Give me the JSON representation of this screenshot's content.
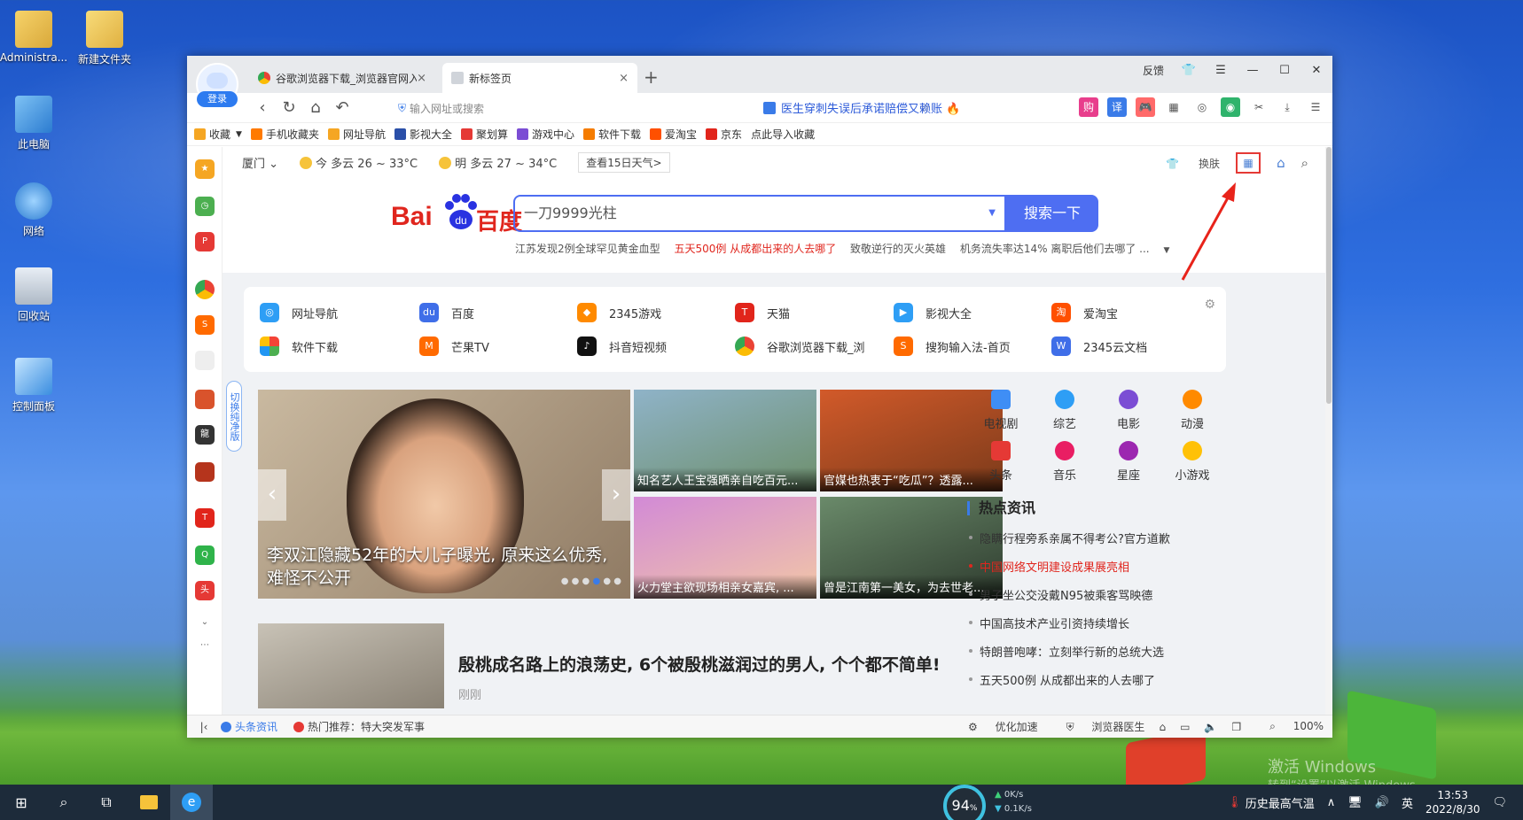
{
  "desktop": {
    "icons": [
      {
        "label": "Administra..."
      },
      {
        "label": "新建文件夹"
      },
      {
        "label": "此电脑"
      },
      {
        "label": "网络"
      },
      {
        "label": "回收站"
      },
      {
        "label": "控制面板"
      }
    ],
    "activation_watermark": "激活 Windows",
    "activation_hint": "转到“设置”以激活 Windows。"
  },
  "browser": {
    "login_label": "登录",
    "tabs": [
      {
        "label": "谷歌浏览器下载_浏览器官网入口",
        "close": "×"
      },
      {
        "label": "新标签页",
        "close": "×"
      }
    ],
    "new_tab": "+",
    "feedback": "反馈",
    "address_placeholder": "输入网址或搜索",
    "ad_text": "医生穿刺失误后承诺赔偿又赖账",
    "bookmarks": [
      {
        "label": "收藏",
        "color": "#f5a623"
      },
      {
        "label": "手机收藏夹",
        "color": "#ff7a00"
      },
      {
        "label": "网址导航",
        "color": "#f5a623"
      },
      {
        "label": "影视大全",
        "color": "#2a4fa8"
      },
      {
        "label": "聚划算",
        "color": "#e53935"
      },
      {
        "label": "游戏中心",
        "color": "#7b4dd4"
      },
      {
        "label": "软件下载",
        "color": "#f57c00"
      },
      {
        "label": "爱淘宝",
        "color": "#ff5000"
      },
      {
        "label": "京东",
        "color": "#e1251b"
      },
      {
        "label": "点此导入收藏",
        "color": "#ffffff"
      }
    ]
  },
  "weather": {
    "city": "厦门",
    "today": "今 多云 26 ~ 33°C",
    "tomorrow": "明 多云 27 ~ 34°C",
    "forecast_button": "查看15日天气>",
    "skin": "换肤"
  },
  "search": {
    "query": "一刀9999光柱",
    "button": "搜索一下",
    "logo_bai": "Bai",
    "logo_du": "du",
    "logo_cn": "百度",
    "hot_links": [
      {
        "text": "江苏发现2例全球罕见黄金血型",
        "red": false
      },
      {
        "text": "五天500例 从成都出来的人去哪了",
        "red": true
      },
      {
        "text": "致敬逆行的灭火英雄",
        "red": false
      },
      {
        "text": "机务流失率达14% 离职后他们去哪了 ...",
        "red": false
      }
    ]
  },
  "sites": [
    {
      "label": "网址导航",
      "color": "#2e9ef5"
    },
    {
      "label": "百度",
      "color": "#3f6ee8"
    },
    {
      "label": "2345游戏",
      "color": "#ff8a00"
    },
    {
      "label": "天猫",
      "color": "#e1251b"
    },
    {
      "label": "影视大全",
      "color": "#2e9ef5"
    },
    {
      "label": "爱淘宝",
      "color": "#ff5000"
    },
    {
      "label": "软件下载",
      "color": "#4caf50"
    },
    {
      "label": "芒果TV",
      "color": "#ff6a00"
    },
    {
      "label": "抖音短视频",
      "color": "#111111"
    },
    {
      "label": "谷歌浏览器下载_浏",
      "color": "#34a853"
    },
    {
      "label": "搜狗输入法-首页",
      "color": "#ff6a00"
    },
    {
      "label": "2345云文档",
      "color": "#3f6ee8"
    }
  ],
  "switch_pure": "切换纯净版",
  "feed": {
    "big_caption": "李双江隐藏52年的大儿子曝光, 原来这么优秀, 难怪不公开",
    "small": [
      {
        "caption": "知名艺人王宝强晒亲自吃百元..."
      },
      {
        "caption": "官媒也热衷于“吃瓜”？透露..."
      },
      {
        "caption": "火力堂主欲现场相亲女嘉宾, ..."
      },
      {
        "caption": "曾是江南第一美女，为去世老..."
      }
    ],
    "article_title": "殷桃成名路上的浪荡史, 6个被殷桃滋润过的男人, 个个都不简单!",
    "article_time": "刚刚"
  },
  "categories": [
    {
      "label": "电视剧",
      "color": "#3f8ef5"
    },
    {
      "label": "综艺",
      "color": "#2e9ef5"
    },
    {
      "label": "电影",
      "color": "#7b4dd4"
    },
    {
      "label": "动漫",
      "color": "#ff8a00"
    },
    {
      "label": "头条",
      "color": "#e53935"
    },
    {
      "label": "音乐",
      "color": "#e91e63"
    },
    {
      "label": "星座",
      "color": "#9c27b0"
    },
    {
      "label": "小游戏",
      "color": "#ffc107"
    }
  ],
  "hot_news": {
    "title": "热点资讯",
    "items": [
      {
        "text": "隐瞒行程旁系亲属不得考公?官方道歉",
        "red": false
      },
      {
        "text": "中国网络文明建设成果展亮相",
        "red": true
      },
      {
        "text": "男子坐公交没戴N95被乘客骂映德",
        "red": false
      },
      {
        "text": "中国高技术产业引资持续增长",
        "red": false
      },
      {
        "text": "特朗普咆哮：立刻举行新的总统大选",
        "red": false
      },
      {
        "text": "五天500例 从成都出来的人去哪了",
        "red": false
      }
    ]
  },
  "statusbar": {
    "toutiao": "头条资讯",
    "hot_recommend": "热门推荐：特大突发军事",
    "optimize": "优化加速",
    "doctor": "浏览器医生",
    "zoom": "100%"
  },
  "taskbar": {
    "speed_percent": "94",
    "speed_unit": "%",
    "up_rate": "0K/s",
    "down_rate": "0.1K/s",
    "weather_text": "历史最高气温",
    "ime": "英",
    "time": "13:53",
    "date": "2022/8/30"
  }
}
